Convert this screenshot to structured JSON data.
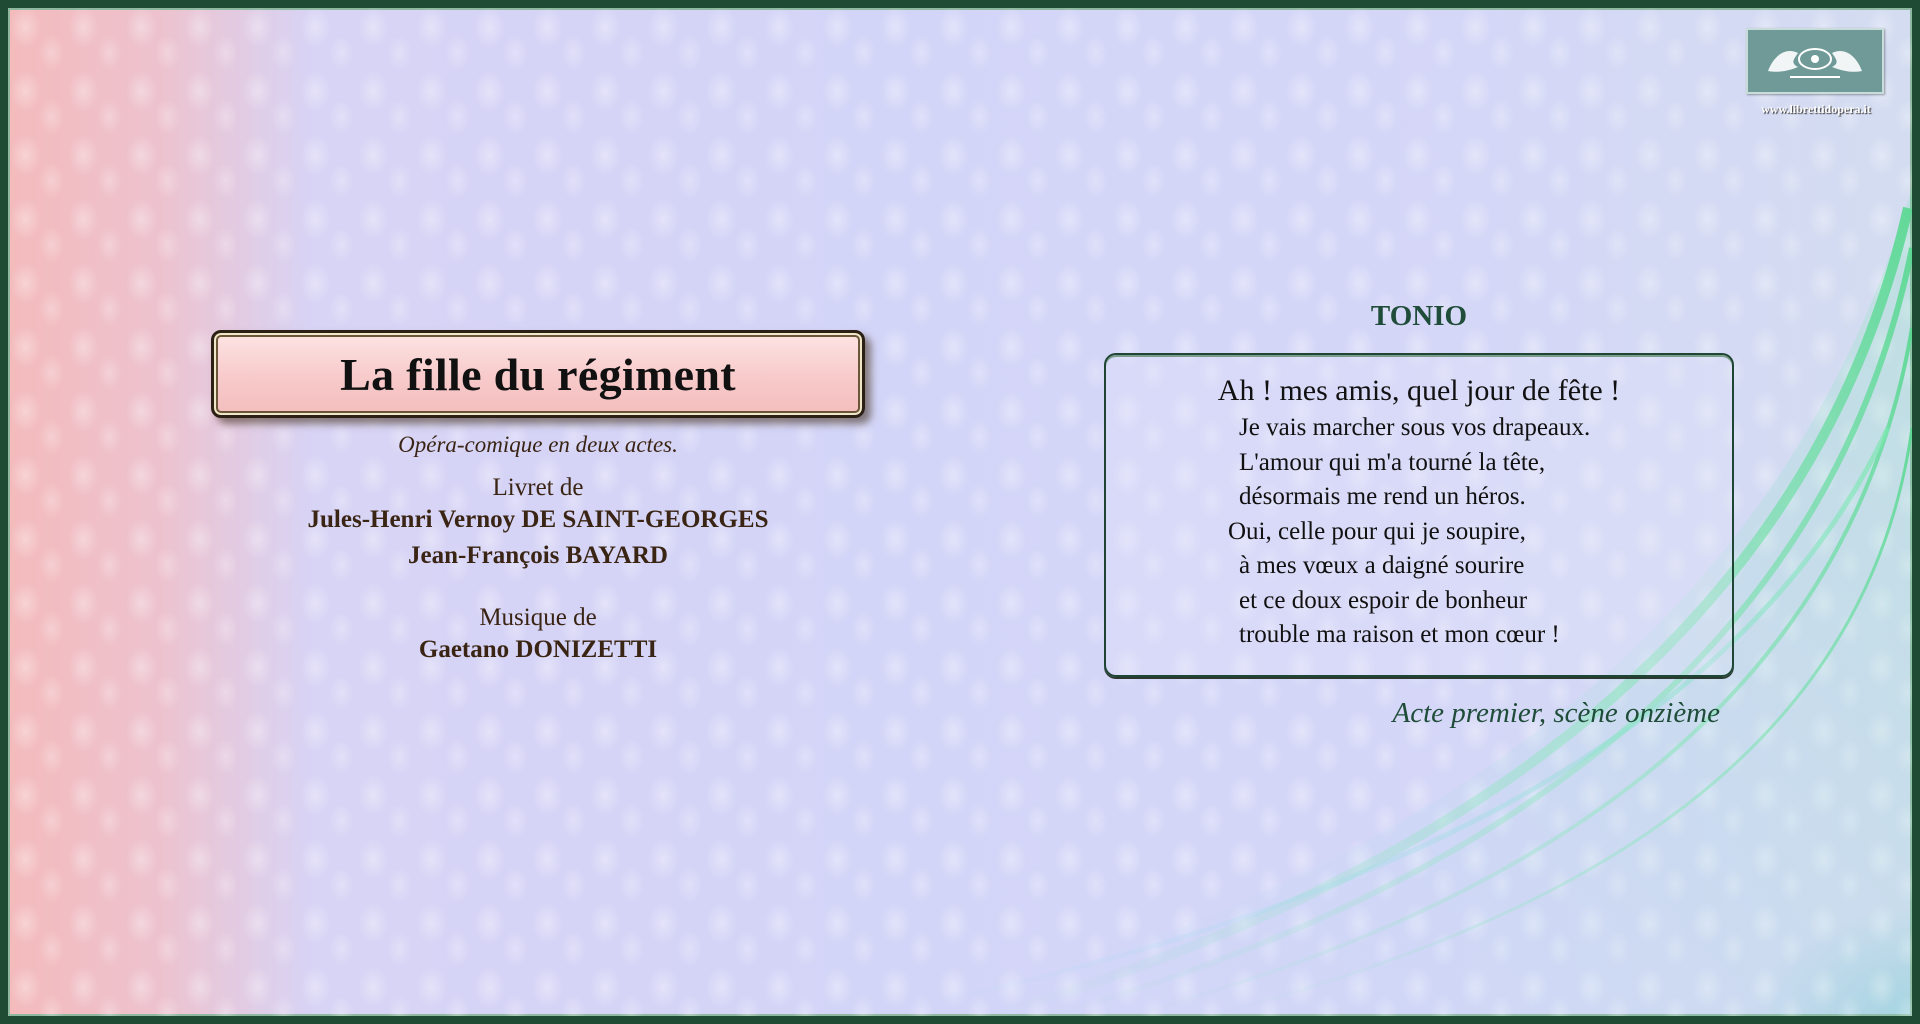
{
  "logo": {
    "icon": "griffins-emblem-icon",
    "url_text": "www.librettidopera.it",
    "bg_color": "#6f9a98"
  },
  "work": {
    "title": "La fille du régiment",
    "subtitle": "Opéra-comique en deux actes.",
    "livret_label": "Livret de",
    "librettists": [
      "Jules-Henri Vernoy DE SAINT-GEORGES",
      "Jean-François BAYARD"
    ],
    "musique_label": "Musique de",
    "composer": "Gaetano DONIZETTI"
  },
  "excerpt": {
    "character": "TONIO",
    "lines": [
      "Ah ! mes amis, quel jour de fête !",
      "Je vais marcher sous vos drapeaux.",
      "L'amour qui m'a tourné la tête,",
      "désormais me rend un héros.",
      "Oui, celle pour qui je soupire,",
      "à mes vœux a daigné sourire",
      "et ce doux espoir de bonheur",
      "trouble ma raison et mon cœur !"
    ],
    "scene": "Acte premier, scène onzième"
  },
  "colors": {
    "border": "#1f4a34",
    "accent_green": "#1f4d3a",
    "text_brown": "#3a2414",
    "title_plate": "#f8caca"
  }
}
